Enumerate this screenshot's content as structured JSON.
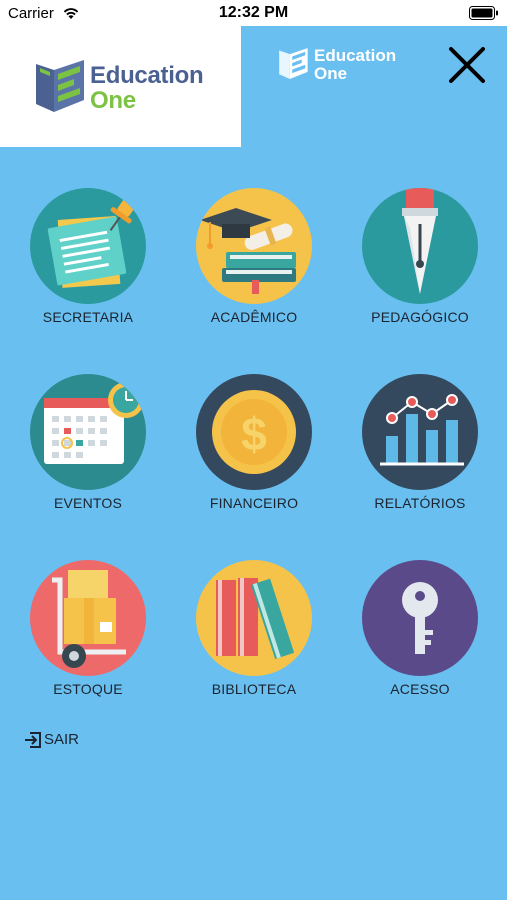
{
  "status_bar": {
    "carrier": "Carrier",
    "time": "12:32 PM"
  },
  "logo": {
    "line1": "Education",
    "line2": "One"
  },
  "header_logo": {
    "line1": "Education",
    "line2": "One"
  },
  "menu": {
    "items": [
      {
        "label": "SECRETARIA",
        "icon": "notes-pin-icon"
      },
      {
        "label": "ACADÊMICO",
        "icon": "graduation-books-icon"
      },
      {
        "label": "PEDAGÓGICO",
        "icon": "fountain-pen-icon"
      },
      {
        "label": "EVENTOS",
        "icon": "calendar-clock-icon"
      },
      {
        "label": "FINANCEIRO",
        "icon": "dollar-coin-icon"
      },
      {
        "label": "RELATÓRIOS",
        "icon": "bar-chart-icon"
      },
      {
        "label": "ESTOQUE",
        "icon": "hand-truck-icon"
      },
      {
        "label": "BIBLIOTECA",
        "icon": "books-icon"
      },
      {
        "label": "ACESSO",
        "icon": "key-icon"
      }
    ]
  },
  "logout": {
    "label": "SAIR"
  },
  "colors": {
    "background": "#69bfef",
    "brand_blue": "#4a6192",
    "brand_green": "#7cc243",
    "label_text": "#1b2430"
  }
}
